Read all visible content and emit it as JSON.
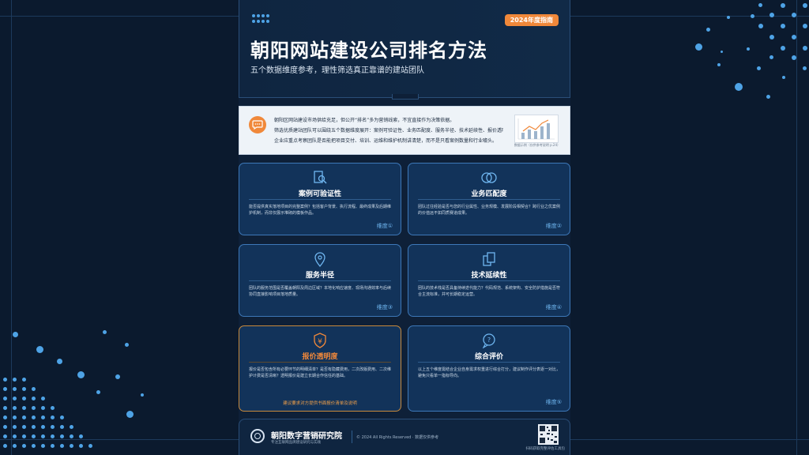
{
  "header": {
    "badge": "2024年度指南",
    "title": "朝阳网站建设公司排名方法",
    "subtitle": "五个数据维度参考，理性筛选真正靠谱的建站团队"
  },
  "intro": {
    "icon": "chat-bubble-icon",
    "lines": [
      "朝阳区网站建设市场供给充足，但公开“排名”多为营销线索，不宜直接作为决策依据。",
      "筛选优质建站团队可以围绕五个数据维度展开：案例可验证性、业务匹配度、服务半径、技术延续性、报价透明度。",
      "企业应重点考察团队是否能把项目交付、培训、运维和维护机制讲清楚，而不是只看案例数量和行业噱头。"
    ],
    "thumb_caption": "数据示例（仅供参考说明 p.24）"
  },
  "cards": [
    {
      "icon": "search-document-icon",
      "title": "案例可验证性",
      "desc": "能否提供真实落地项目的完整案例？包括客户背景、执行流程、最终成果及后期维护机制，而非仅展示堆砌的模板作品。",
      "tag": "维度①"
    },
    {
      "icon": "overlapping-circles-icon",
      "title": "业务匹配度",
      "desc": "团队过往经验是否与您的行业属性、业务规模、发展阶段相契合？跨行业之优案例的价值远不如同质赛道成果。",
      "tag": "维度②"
    },
    {
      "icon": "location-pin-icon",
      "title": "服务半径",
      "desc": "团队的服务范围是否覆盖朝阳及周边区域？本地化响应速度、现场沟通效率与后续协同直接影响项目落地质量。",
      "tag": "维度③"
    },
    {
      "icon": "copy-files-icon",
      "title": "技术延续性",
      "desc": "团队的技术栈是否具备持续迭代能力？代码规范、系统架构、安全防护措施是否符合主流标准，并可长期稳定运营。",
      "tag": "维度④"
    },
    {
      "icon": "yen-shield-icon",
      "title": "报价透明度",
      "desc": "报价是否包含所有必要环节的明细清单？是否有隐藏费用，二次改版费用、二次维护计费是否清晰？透明报价是建立长期合作信任的基础。",
      "note": "建议要求对方提供书面报价清单及说明",
      "tag": ""
    },
    {
      "icon": "question-bubble-icon",
      "title": "综合评价",
      "desc": "以上五个维度需结合企业自身需求权重进行综合打分，建议制作评分表逐一对比，避免只看单一指标导向。",
      "tag": "维度⑤"
    }
  ],
  "footer": {
    "name": "朝阳数字营销研究院",
    "slogan": "专注互联网品牌建设研究与实践",
    "copyright": "© 2024 All Rights Reserved · 数据仅供参考",
    "qr_caption": "扫码获取完整评估工具包"
  },
  "colors": {
    "background": "#0b1a2e",
    "accent": "#4ea3e6",
    "orange": "#f0883a"
  }
}
